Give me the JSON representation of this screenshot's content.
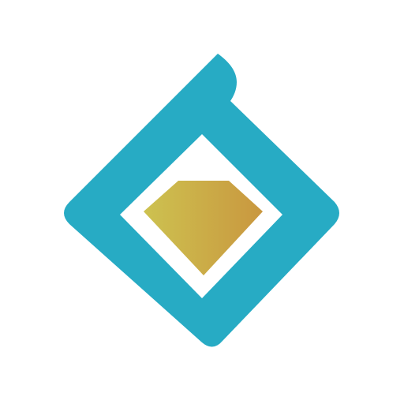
{
  "logo": {
    "icon_name": "diamond-gem-logo-icon",
    "frame_color": "#27abc4",
    "inner_color": "#ffffff",
    "gem_gradient_start": "#cdc250",
    "gem_gradient_end": "#c9973f",
    "background_color": "#ffffff"
  }
}
